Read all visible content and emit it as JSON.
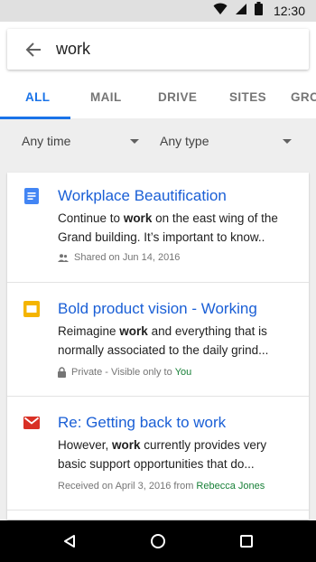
{
  "status_bar": {
    "time": "12:30",
    "icons": [
      "wifi-icon",
      "signal-icon",
      "battery-icon"
    ]
  },
  "search": {
    "query": "work",
    "back_icon": "arrow-back-icon"
  },
  "tabs": [
    {
      "label": "ALL",
      "active": true
    },
    {
      "label": "MAIL",
      "active": false
    },
    {
      "label": "DRIVE",
      "active": false
    },
    {
      "label": "SITES",
      "active": false
    },
    {
      "label": "GRO",
      "active": false
    }
  ],
  "filters": {
    "time": "Any time",
    "type": "Any type"
  },
  "results": [
    {
      "icon": "docs-icon",
      "title": "Workplace Beautification",
      "snippet_before": "Continue to ",
      "snippet_bold": "work",
      "snippet_after": " on the east wing of the Grand building. It’s important to know..",
      "meta_icon": "people-icon",
      "meta": "Shared on Jun 14, 2016",
      "meta_highlight": ""
    },
    {
      "icon": "slides-icon",
      "title": "Bold product vision - Working",
      "snippet_before": "Reimagine ",
      "snippet_bold": "work",
      "snippet_after": " and everything that is normally associated to the daily grind...",
      "meta_icon": "lock-icon",
      "meta": "Private - Visible only to",
      "meta_highlight": "You"
    },
    {
      "icon": "gmail-icon",
      "title": "Re: Getting back to work",
      "snippet_before": "However, ",
      "snippet_bold": "work",
      "snippet_after": " currently provides very basic support opportunities that do...",
      "meta_icon": "",
      "meta": "Received on April 3, 2016 from",
      "meta_highlight": "Rebecca Jones"
    }
  ],
  "colors": {
    "accent": "#1a73e8",
    "link": "#1a5fd6",
    "highlight": "#188038",
    "docs": "#4285f4",
    "slides": "#f4b400",
    "gmail": "#d93025"
  },
  "nav": [
    "back-nav-icon",
    "home-nav-icon",
    "recents-nav-icon"
  ]
}
